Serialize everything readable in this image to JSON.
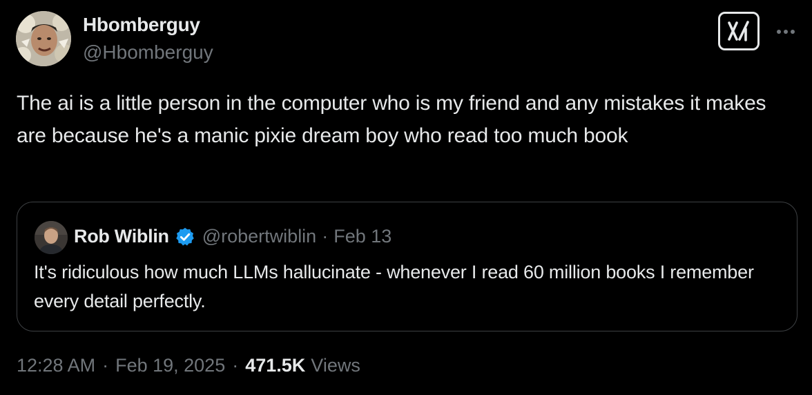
{
  "tweet": {
    "author": {
      "display_name": "Hbomberguy",
      "handle": "@Hbomberguy",
      "avatar_icon": "profile-photo"
    },
    "text": "The ai is a little person in the computer who is my friend and any mistakes it makes are because he's a manic pixie dream boy who read too much book",
    "actions": {
      "grok_icon": "grok-icon",
      "more_icon": "more-horizontal-icon"
    },
    "quote": {
      "author": {
        "display_name": "Rob Wiblin",
        "handle": "@robertwiblin",
        "verified": true,
        "verified_icon": "verified-badge-icon"
      },
      "separator": "·",
      "date": "Feb 13",
      "text": "It's ridiculous how much LLMs hallucinate - whenever I read 60 million books I remember every detail perfectly."
    },
    "meta": {
      "time": "12:28 AM",
      "separator": "·",
      "date": "Feb 19, 2025",
      "views_count": "471.5K",
      "views_label": "Views"
    }
  },
  "colors": {
    "background": "#000000",
    "primary_text": "#e7e9ea",
    "secondary_text": "#71767b",
    "border": "#3e4144",
    "verified_blue": "#1d9bf0"
  }
}
